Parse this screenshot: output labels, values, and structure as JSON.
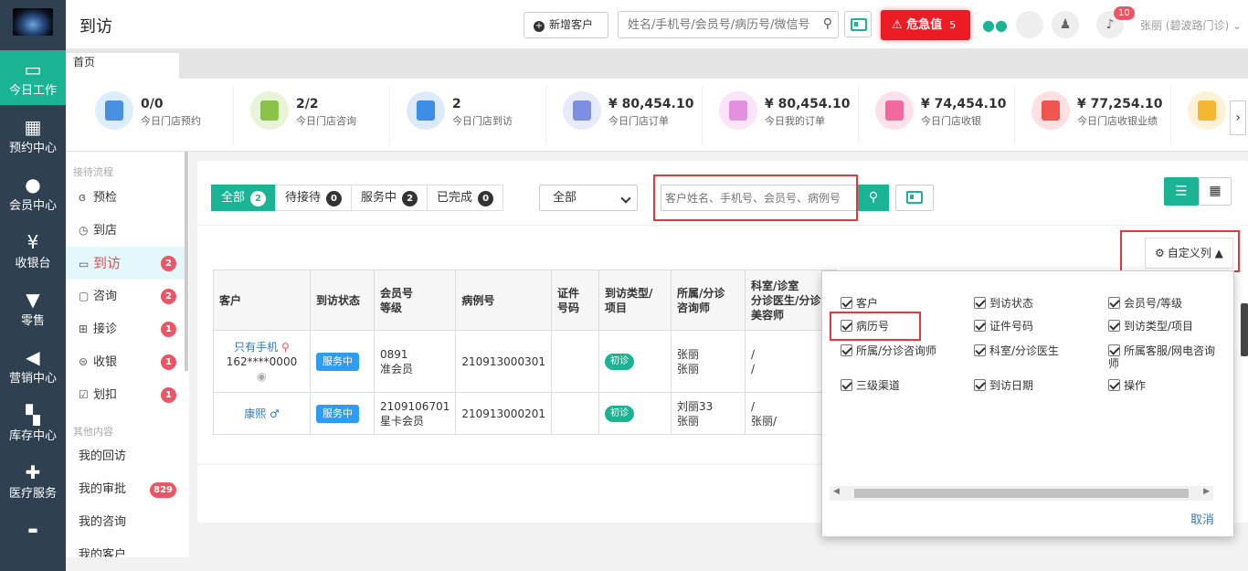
{
  "sidebar": {
    "items": [
      {
        "label": "今日工作",
        "icon": "laptop-icon",
        "active": true
      },
      {
        "label": "预约中心",
        "icon": "calendar-icon"
      },
      {
        "label": "会员中心",
        "icon": "users-icon"
      },
      {
        "label": "收银台",
        "icon": "yen-icon"
      },
      {
        "label": "零售",
        "icon": "cart-icon"
      },
      {
        "label": "营销中心",
        "icon": "megaphone-icon"
      },
      {
        "label": "库存中心",
        "icon": "grid-icon"
      },
      {
        "label": "医疗服务",
        "icon": "medkit-icon"
      }
    ]
  },
  "header": {
    "title": "到访",
    "new_customer": "新增客户",
    "search_placeholder": "姓名/手机号/会员号/病历号/微信号",
    "danger_label": "危急值",
    "danger_count": "5",
    "bell_badge": "10",
    "user": "张丽 (碧波路门诊)"
  },
  "tabs": {
    "home": "首页"
  },
  "stats": [
    {
      "value": "0/0",
      "label": "今日门店预约",
      "color": "#4a90e2",
      "bg": "#dceefd"
    },
    {
      "value": "2/2",
      "label": "今日门店咨询",
      "color": "#8bc34a",
      "bg": "#e8f3d8"
    },
    {
      "value": "2",
      "label": "今日门店到访",
      "color": "#3d8ee8",
      "bg": "#dceafc"
    },
    {
      "value": "¥ 80,454.10",
      "label": "今日门店订单",
      "color": "#7c8fe0",
      "bg": "#e6eafb"
    },
    {
      "value": "¥ 80,454.10",
      "label": "今日我的订单",
      "color": "#e58fe0",
      "bg": "#fbe3f8"
    },
    {
      "value": "¥ 74,454.10",
      "label": "今日门店收银",
      "color": "#f06aa0",
      "bg": "#fde0ec"
    },
    {
      "value": "¥ 77,254.10",
      "label": "今日门店收银业绩",
      "color": "#f0544f",
      "bg": "#fde0df"
    },
    {
      "value": "",
      "label": "",
      "color": "#f5b731",
      "bg": "#fdf1d6"
    }
  ],
  "subnav": {
    "group1": "接待流程",
    "group2": "其他内容",
    "items": [
      {
        "label": "预检",
        "icon": "stethoscope-icon",
        "badge": ""
      },
      {
        "label": "到店",
        "icon": "history-icon",
        "badge": ""
      },
      {
        "label": "到访",
        "icon": "card-icon",
        "badge": "2",
        "selected": true
      },
      {
        "label": "咨询",
        "icon": "chat-icon",
        "badge": "2"
      },
      {
        "label": "接诊",
        "icon": "clinic-icon",
        "badge": "1"
      },
      {
        "label": "收银",
        "icon": "coin-icon",
        "badge": "1"
      },
      {
        "label": "划扣",
        "icon": "checkbox-icon",
        "badge": "1"
      }
    ],
    "others": [
      {
        "label": "我的回访",
        "badge": ""
      },
      {
        "label": "我的审批",
        "badge": "829"
      },
      {
        "label": "我的咨询",
        "badge": ""
      },
      {
        "label": "我的客户",
        "badge": ""
      }
    ]
  },
  "filter": {
    "tabs": [
      {
        "label": "全部",
        "count": "2"
      },
      {
        "label": "待接待",
        "count": "0"
      },
      {
        "label": "服务中",
        "count": "2"
      },
      {
        "label": "已完成",
        "count": "0"
      }
    ],
    "select": "全部",
    "search_placeholder": "客户姓名、手机号、会员号、病例号",
    "custom_cols": "自定义列"
  },
  "table": {
    "headers": [
      "客户",
      "到访状态",
      "会员号\n等级",
      "病例号",
      "证件\n号码",
      "到访类型/\n项目",
      "所属/分诊\n咨询师",
      "科室/诊室\n分诊医生/分诊\n美容师"
    ],
    "rows": [
      {
        "name": "只有手机",
        "phone": "162****0000",
        "status": "服务中",
        "member": "0891",
        "level": "准会员",
        "case": "210913000301",
        "id": "",
        "type": "初诊",
        "staff1": "张丽",
        "staff2": "张丽",
        "dept1": "/",
        "dept2": "/"
      },
      {
        "name": "康熙 ♂",
        "phone": "",
        "status": "服务中",
        "member": "2109106701",
        "level": "星卡会员",
        "case": "210913000201",
        "id": "",
        "type": "初诊",
        "staff1": "刘丽33",
        "staff2": "张丽",
        "dept1": "/",
        "dept2": "张丽/"
      }
    ]
  },
  "columns_menu": {
    "options": [
      "客户",
      "到访状态",
      "会员号/等级",
      "病历号",
      "证件号码",
      "到访类型/项目",
      "所属/分诊咨询师",
      "科室/分诊医生",
      "所属客服/网电咨询师",
      "三级渠道",
      "到访日期",
      "操作"
    ],
    "cancel": "取消"
  }
}
